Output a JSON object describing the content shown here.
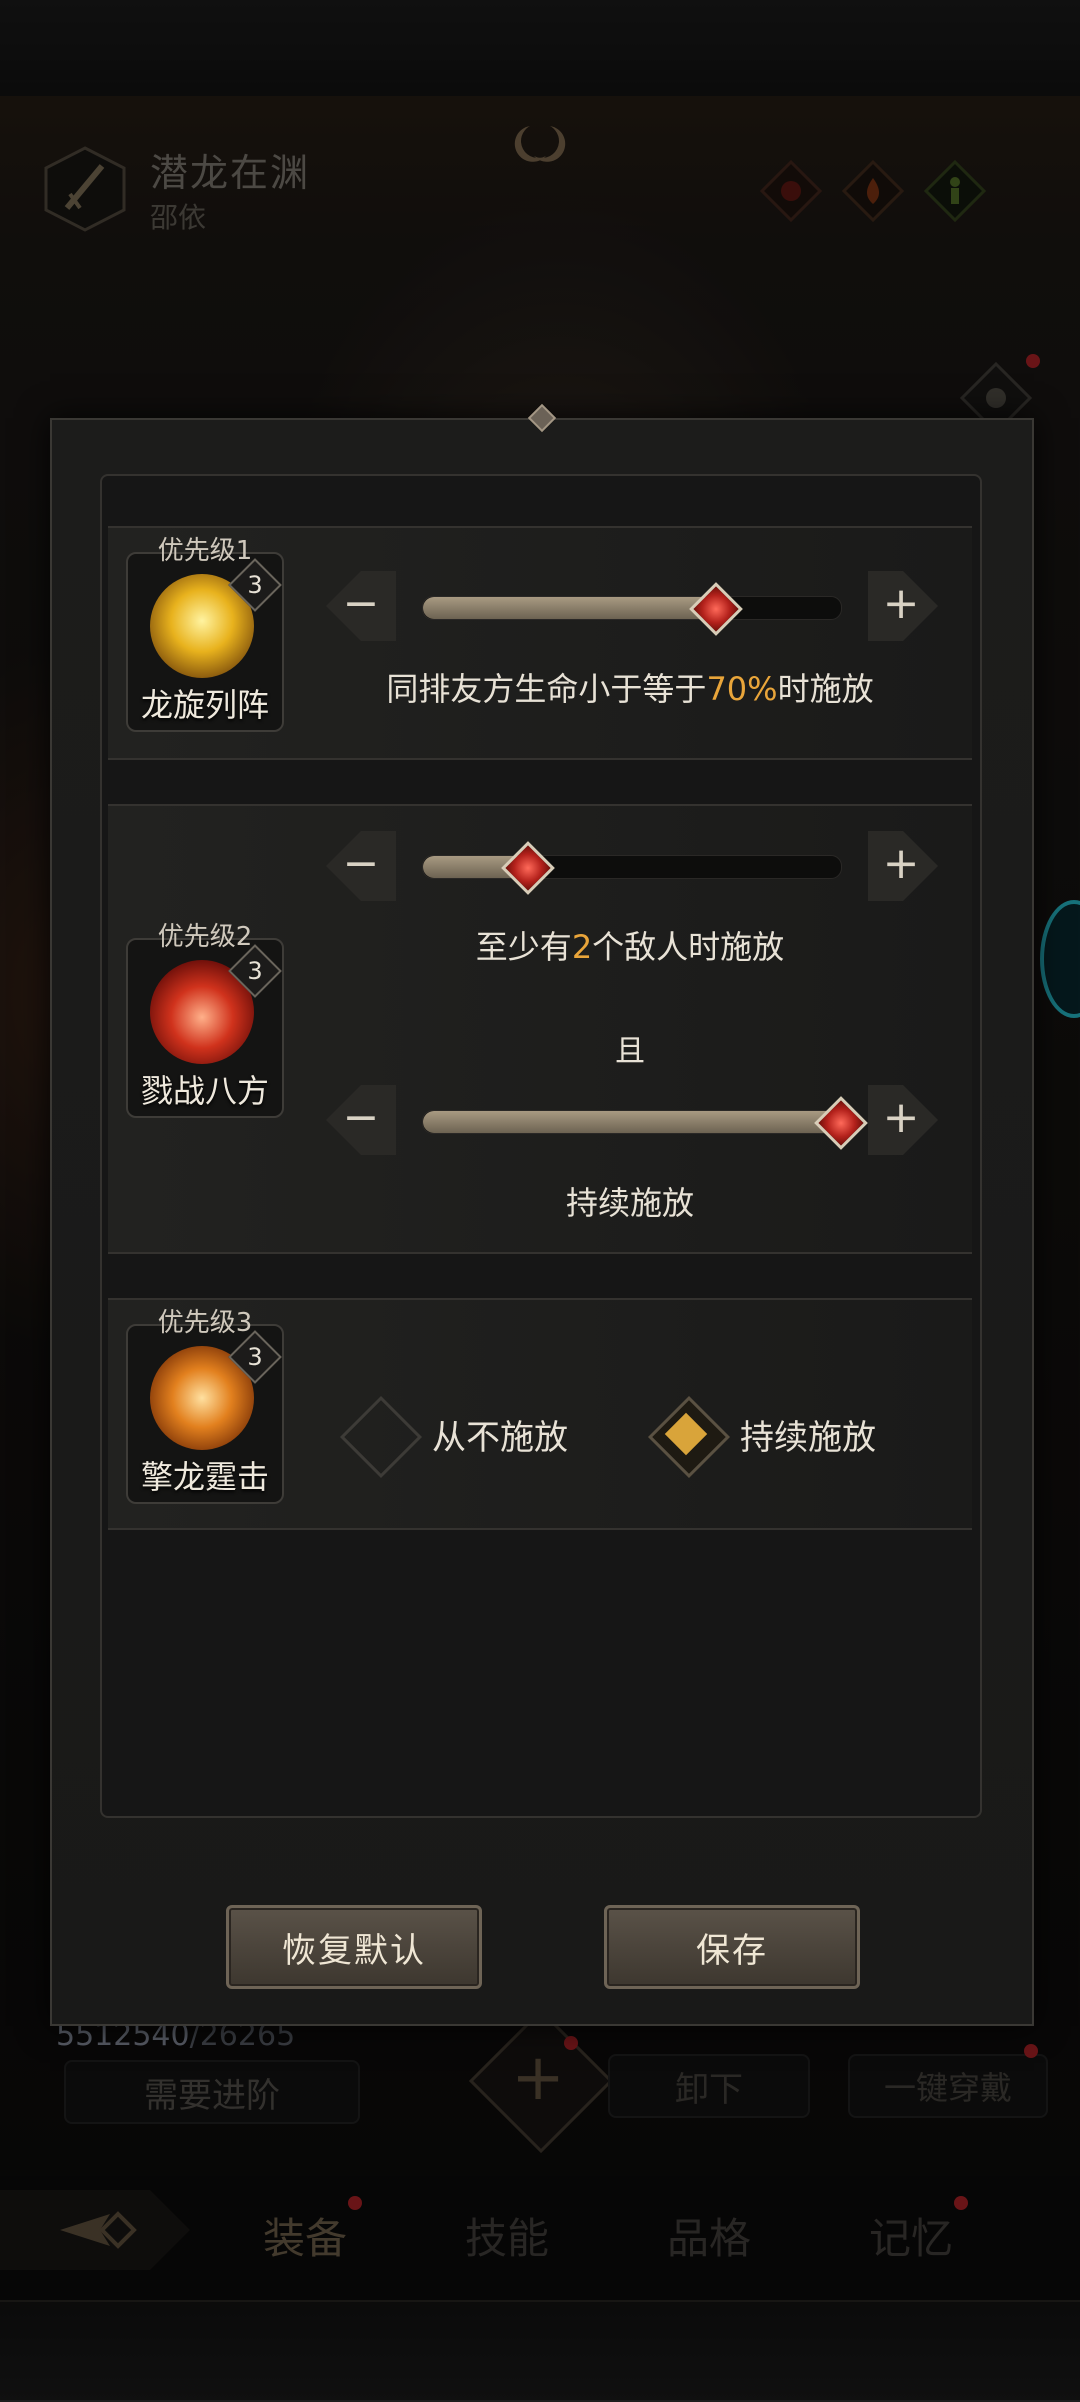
{
  "hero": {
    "title": "潜龙在渊",
    "subtitle": "邵依"
  },
  "background": {
    "exp_current": "5512540",
    "exp_required": "/26265",
    "advance_button": "需要进阶",
    "unequip_button": "卸下",
    "equip_all_button": "一键穿戴",
    "tabs": [
      {
        "label": "装备",
        "active": true,
        "has_dot": true
      },
      {
        "label": "技能",
        "active": false,
        "has_dot": false
      },
      {
        "label": "品格",
        "active": false,
        "has_dot": false
      },
      {
        "label": "记忆",
        "active": false,
        "has_dot": true
      }
    ]
  },
  "modal": {
    "skills": [
      {
        "priority": "优先级1",
        "name": "龙旋列阵",
        "level": "3",
        "icon": "golden-vortex-icon",
        "slider_value": 0.7,
        "condition_prefix": "同排友方生命小于等于",
        "condition_value": "70%",
        "condition_suffix": "时施放"
      },
      {
        "priority": "优先级2",
        "name": "戮战八方",
        "level": "3",
        "icon": "red-burst-icon",
        "slider_1_value": 0.25,
        "condition_1_prefix": "至少有",
        "condition_1_value": "2",
        "condition_1_suffix": "个敌人时施放",
        "connector": "且",
        "slider_2_value": 1.0,
        "condition_2": "持续施放"
      },
      {
        "priority": "优先级3",
        "name": "擎龙霆击",
        "level": "3",
        "icon": "fire-swirl-icon",
        "option_never": "从不施放",
        "option_always": "持续施放",
        "selected": "always"
      }
    ],
    "reset_button": "恢复默认",
    "save_button": "保存"
  },
  "colors": {
    "highlight": "#e9a53a",
    "accent_red": "#c0262b",
    "panel": "#1c1c1b"
  }
}
